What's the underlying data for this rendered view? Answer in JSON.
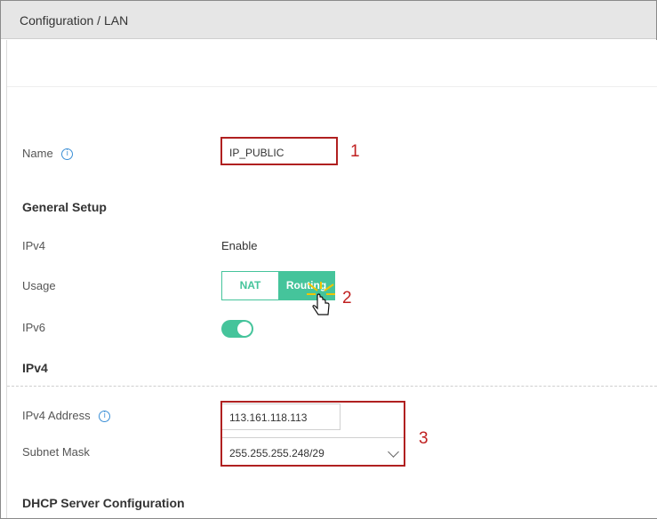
{
  "window": {
    "title": "Configuration / LAN"
  },
  "form": {
    "name_label": "Name",
    "name_value": "IP_PUBLIC",
    "general_setup_title": "General Setup",
    "ipv4_label": "IPv4",
    "ipv4_value": "Enable",
    "usage_label": "Usage",
    "usage_options": [
      "NAT",
      "Routing"
    ],
    "usage_selected": "Routing",
    "ipv6_label": "IPv6",
    "ipv6_enabled": true,
    "ipv4_section_title": "IPv4",
    "ipv4_address_label": "IPv4 Address",
    "ipv4_address_value": "113.161.118.113",
    "subnet_mask_label": "Subnet Mask",
    "subnet_mask_value": "255.255.255.248/29",
    "dhcp_section_title": "DHCP Server Configuration"
  },
  "callouts": {
    "one": "1",
    "two": "2",
    "three": "3"
  },
  "icons": {
    "info": "info-icon",
    "dropdown": "chevron-down-icon",
    "cursor": "hand-cursor-icon"
  },
  "colors": {
    "accent": "#45c49b",
    "highlight": "#b02020"
  }
}
